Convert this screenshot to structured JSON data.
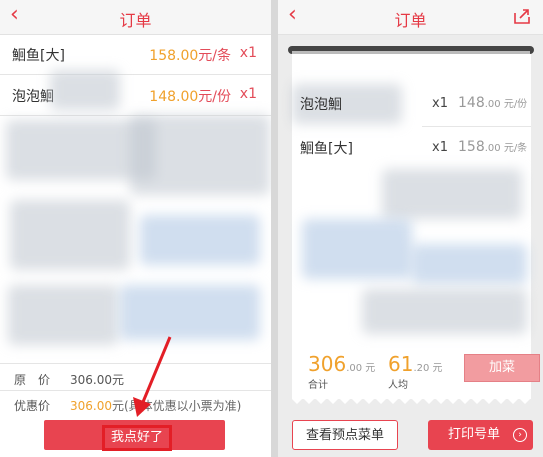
{
  "left": {
    "title": "订单",
    "items": [
      {
        "name": "鮰鱼[大]",
        "price": "158.00",
        "unit": "元/条",
        "qty": "x1"
      },
      {
        "name": "泡泡鮰",
        "price": "148.00",
        "unit": "元/份",
        "qty": "x1"
      }
    ],
    "original_price_label": "原　价",
    "original_price_value": "306.00元",
    "discount_label": "优惠价",
    "discount_value": "306.00",
    "discount_suffix": "元(具体优惠以小票为准)",
    "confirm_button": "我点好了"
  },
  "right": {
    "title": "订单",
    "receipt_items": [
      {
        "name": "泡泡鮰",
        "qty": "x1",
        "price": "148",
        "decimals": ".00 元/份"
      },
      {
        "name": "鮰鱼[大]",
        "qty": "x1",
        "price": "158",
        "decimals": ".00 元/条"
      }
    ],
    "total_value": "306",
    "total_decimals": ".00 元",
    "total_label": "合计",
    "per_person_value": "61",
    "per_person_decimals": ".20 元",
    "per_person_label": "人均",
    "add_dish_button": "加菜",
    "view_menu_button": "查看预点菜单",
    "print_button": "打印号单",
    "print_icon": "›"
  },
  "colors": {
    "accent": "#e84450",
    "price": "#f0a12c"
  },
  "icons": [
    "back-chevron-icon",
    "share-icon",
    "arrow-annotation",
    "chevron-right-icon"
  ]
}
